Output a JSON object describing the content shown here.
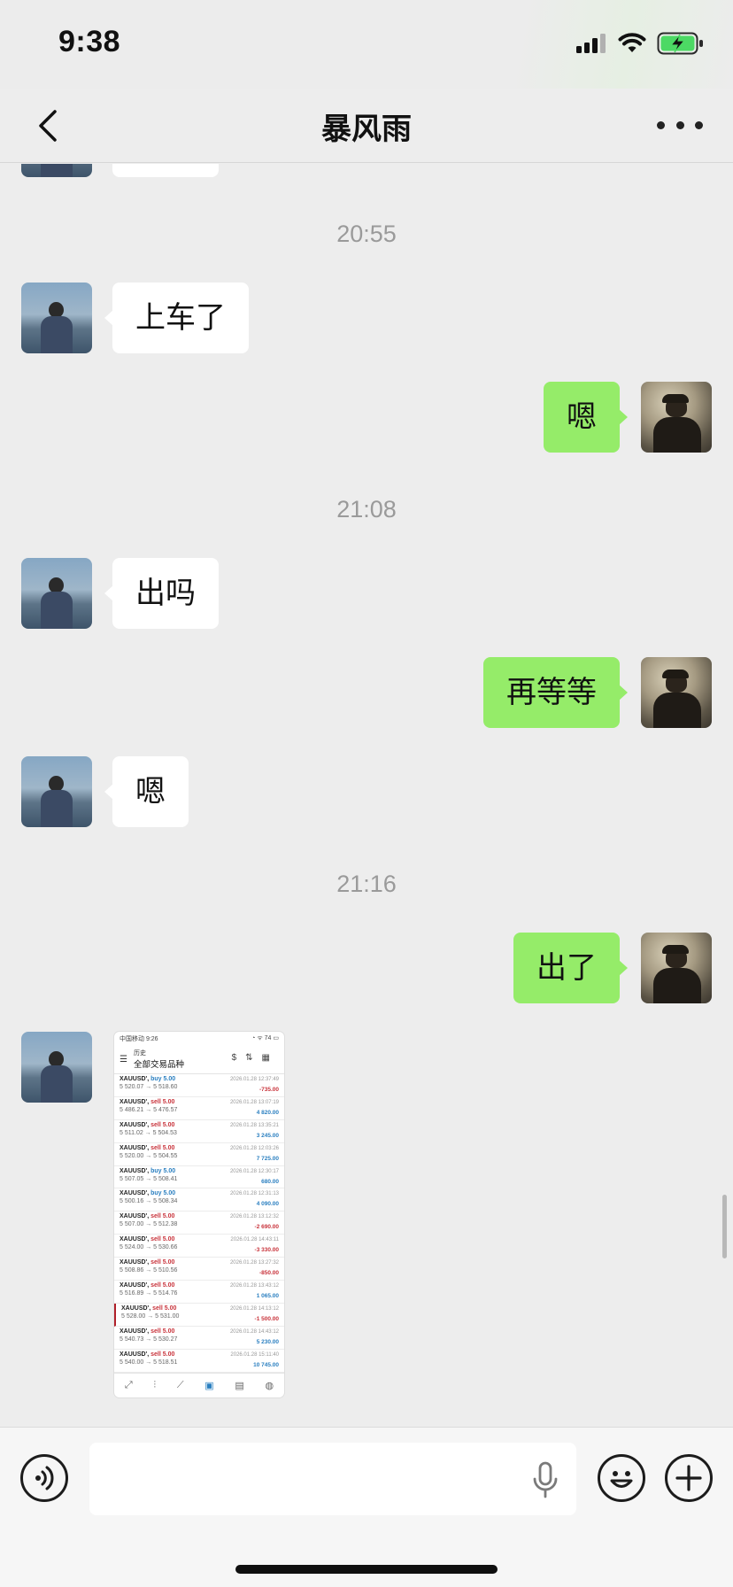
{
  "status_bar": {
    "time": "9:38",
    "icons": [
      "signal-icon",
      "wifi-icon",
      "battery-charging-icon"
    ]
  },
  "nav": {
    "title": "暴风雨",
    "back_icon": "back-chevron-icon",
    "more_icon": "more-dots-icon"
  },
  "messages": [
    {
      "type": "timestamp",
      "text": "20:55"
    },
    {
      "type": "text",
      "from": "friend",
      "text": "上车了"
    },
    {
      "type": "text",
      "from": "me",
      "text": "嗯"
    },
    {
      "type": "timestamp",
      "text": "21:08"
    },
    {
      "type": "text",
      "from": "friend",
      "text": "出吗"
    },
    {
      "type": "text",
      "from": "me",
      "text": "再等等"
    },
    {
      "type": "text",
      "from": "friend",
      "text": "嗯"
    },
    {
      "type": "timestamp",
      "text": "21:16"
    },
    {
      "type": "text",
      "from": "me",
      "text": "出了"
    },
    {
      "type": "image",
      "from": "friend"
    }
  ],
  "screenshot": {
    "status_time": "中国移动 9:26",
    "status_right": "◔ ᯤ 74 ▭",
    "header_small": "历史",
    "header_title": "全部交易品种",
    "trades": [
      {
        "symbol": "XAUUSD'",
        "side": "buy",
        "vol": "5.00",
        "prices": "5 520.07 → 5 518.60",
        "date": "2026.01.28 12:37:49",
        "pl": "-735.00",
        "neg": true,
        "marked": false
      },
      {
        "symbol": "XAUUSD'",
        "side": "sell",
        "vol": "5.00",
        "prices": "5 486.21 → 5 476.57",
        "date": "2026.01.28 13:07:19",
        "pl": "4 820.00",
        "neg": false,
        "marked": false
      },
      {
        "symbol": "XAUUSD'",
        "side": "sell",
        "vol": "5.00",
        "prices": "5 511.02 → 5 504.53",
        "date": "2026.01.28 13:35:21",
        "pl": "3 245.00",
        "neg": false,
        "marked": false
      },
      {
        "symbol": "XAUUSD'",
        "side": "sell",
        "vol": "5.00",
        "prices": "5 520.00 → 5 504.55",
        "date": "2026.01.28 12:03:26",
        "pl": "7 725.00",
        "neg": false,
        "marked": false
      },
      {
        "symbol": "XAUUSD'",
        "side": "buy",
        "vol": "5.00",
        "prices": "5 507.05 → 5 508.41",
        "date": "2026.01.28 12:30:17",
        "pl": "680.00",
        "neg": false,
        "marked": false
      },
      {
        "symbol": "XAUUSD'",
        "side": "buy",
        "vol": "5.00",
        "prices": "5 500.16 → 5 508.34",
        "date": "2026.01.28 12:31:13",
        "pl": "4 090.00",
        "neg": false,
        "marked": false
      },
      {
        "symbol": "XAUUSD'",
        "side": "sell",
        "vol": "5.00",
        "prices": "5 507.00 → 5 512.38",
        "date": "2026.01.28 13:12:32",
        "pl": "-2 690.00",
        "neg": true,
        "marked": false
      },
      {
        "symbol": "XAUUSD'",
        "side": "sell",
        "vol": "5.00",
        "prices": "5 524.00 → 5 530.66",
        "date": "2026.01.28 14:43:11",
        "pl": "-3 330.00",
        "neg": true,
        "marked": false
      },
      {
        "symbol": "XAUUSD'",
        "side": "sell",
        "vol": "5.00",
        "prices": "5 508.86 → 5 510.56",
        "date": "2026.01.28 13:27:32",
        "pl": "-850.00",
        "neg": true,
        "marked": false
      },
      {
        "symbol": "XAUUSD'",
        "side": "sell",
        "vol": "5.00",
        "prices": "5 516.89 → 5 514.76",
        "date": "2026.01.28 13:43:12",
        "pl": "1 065.00",
        "neg": false,
        "marked": false
      },
      {
        "symbol": "XAUUSD'",
        "side": "sell",
        "vol": "5.00",
        "prices": "5 528.00 → 5 531.00",
        "date": "2026.01.28 14:13:12",
        "pl": "-1 500.00",
        "neg": true,
        "marked": true
      },
      {
        "symbol": "XAUUSD'",
        "side": "sell",
        "vol": "5.00",
        "prices": "5 540.73 → 5 530.27",
        "date": "2026.01.28 14:43:12",
        "pl": "5 230.00",
        "neg": false,
        "marked": false
      },
      {
        "symbol": "XAUUSD'",
        "side": "sell",
        "vol": "5.00",
        "prices": "5 540.00 → 5 518.51",
        "date": "2026.01.28 15:11:40",
        "pl": "10 745.00",
        "neg": false,
        "marked": false
      }
    ],
    "tab_icons": [
      "trend-icon",
      "candles-icon",
      "chart-icon",
      "history-icon",
      "news-icon",
      "chat-icon"
    ]
  },
  "input_bar": {
    "placeholder": "",
    "value": ""
  },
  "colors": {
    "background": "#ededed",
    "bubble_out": "#95ec69",
    "bubble_in": "#ffffff",
    "buy": "#2a7fc0",
    "sell": "#c8323a"
  }
}
